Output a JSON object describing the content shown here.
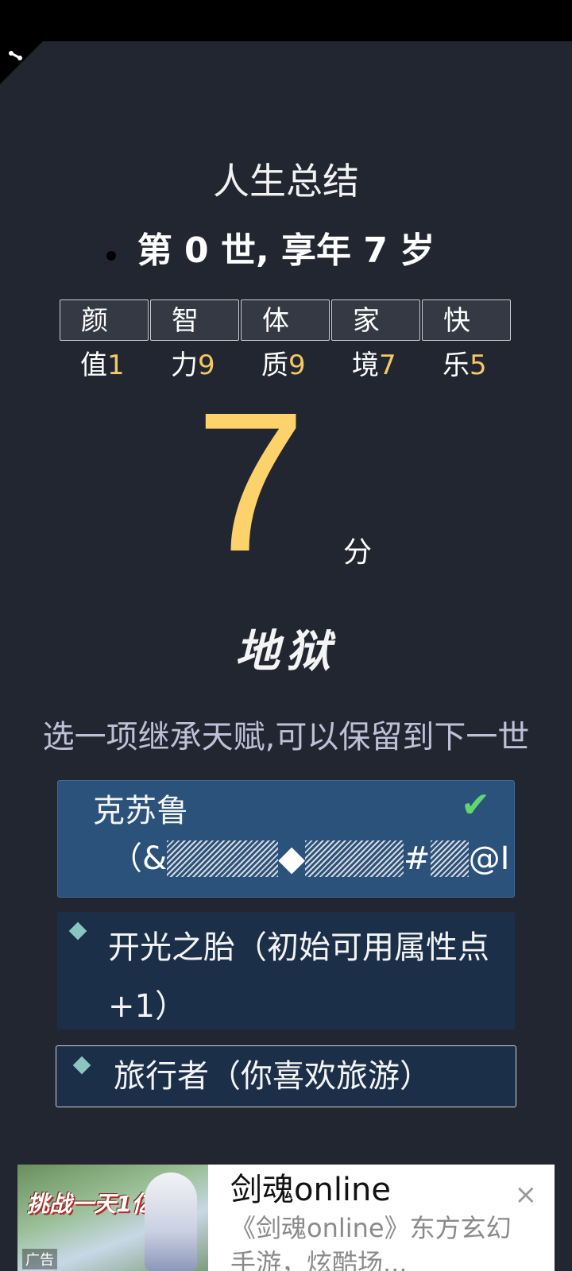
{
  "summary": {
    "title": "人生总结",
    "life_line": "第 0 世, 享年 7 岁"
  },
  "attributes": [
    {
      "top": "颜",
      "bottom": "值",
      "value": "1"
    },
    {
      "top": "智",
      "bottom": "力",
      "value": "9"
    },
    {
      "top": "体",
      "bottom": "质",
      "value": "9"
    },
    {
      "top": "家",
      "bottom": "境",
      "value": "7"
    },
    {
      "top": "快",
      "bottom": "乐",
      "value": "5"
    }
  ],
  "score": {
    "value": "7",
    "unit": "分"
  },
  "grade": "地狱",
  "inherit_prompt": "选一项继承天赋,可以保留到下一世",
  "talents": [
    {
      "name": "克苏鲁",
      "desc_parts": [
        "（&",
        "◆",
        "#",
        "@I"
      ],
      "selected": true
    },
    {
      "name": "开光之胎（初始可用属性点+1）",
      "selected": false
    },
    {
      "name": "旅行者（你喜欢旅游）",
      "selected": false
    }
  ],
  "ad": {
    "image_text": "挑战一天1亿",
    "image_label": "广告",
    "title": "剑魂online",
    "description": "《剑魂online》东方玄幻手游，炫酷场...",
    "close": "×"
  },
  "colors": {
    "background": "#222630",
    "score": "#fdd26a",
    "attr_value": "#f5c865",
    "selected_talent": "#2b527a",
    "talent": "#1c2f49",
    "check": "#5fd66e"
  },
  "icons": [
    "menu-corner-icon",
    "check-icon",
    "diamond-bullet-icon",
    "close-icon"
  ]
}
